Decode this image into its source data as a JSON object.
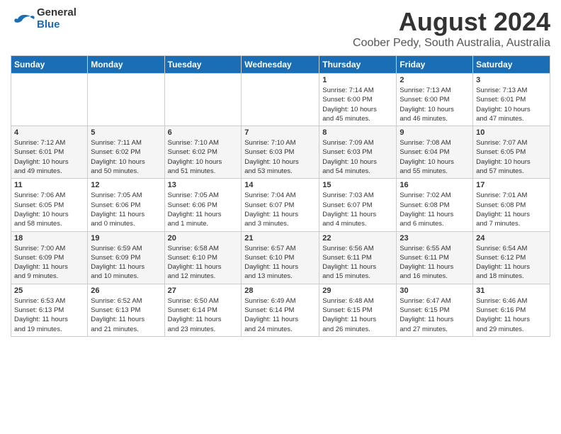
{
  "header": {
    "logo_general": "General",
    "logo_blue": "Blue",
    "main_title": "August 2024",
    "subtitle": "Coober Pedy, South Australia, Australia"
  },
  "days_of_week": [
    "Sunday",
    "Monday",
    "Tuesday",
    "Wednesday",
    "Thursday",
    "Friday",
    "Saturday"
  ],
  "weeks": [
    [
      {
        "day": "",
        "content": ""
      },
      {
        "day": "",
        "content": ""
      },
      {
        "day": "",
        "content": ""
      },
      {
        "day": "",
        "content": ""
      },
      {
        "day": "1",
        "content": "Sunrise: 7:14 AM\nSunset: 6:00 PM\nDaylight: 10 hours\nand 45 minutes."
      },
      {
        "day": "2",
        "content": "Sunrise: 7:13 AM\nSunset: 6:00 PM\nDaylight: 10 hours\nand 46 minutes."
      },
      {
        "day": "3",
        "content": "Sunrise: 7:13 AM\nSunset: 6:01 PM\nDaylight: 10 hours\nand 47 minutes."
      }
    ],
    [
      {
        "day": "4",
        "content": "Sunrise: 7:12 AM\nSunset: 6:01 PM\nDaylight: 10 hours\nand 49 minutes."
      },
      {
        "day": "5",
        "content": "Sunrise: 7:11 AM\nSunset: 6:02 PM\nDaylight: 10 hours\nand 50 minutes."
      },
      {
        "day": "6",
        "content": "Sunrise: 7:10 AM\nSunset: 6:02 PM\nDaylight: 10 hours\nand 51 minutes."
      },
      {
        "day": "7",
        "content": "Sunrise: 7:10 AM\nSunset: 6:03 PM\nDaylight: 10 hours\nand 53 minutes."
      },
      {
        "day": "8",
        "content": "Sunrise: 7:09 AM\nSunset: 6:03 PM\nDaylight: 10 hours\nand 54 minutes."
      },
      {
        "day": "9",
        "content": "Sunrise: 7:08 AM\nSunset: 6:04 PM\nDaylight: 10 hours\nand 55 minutes."
      },
      {
        "day": "10",
        "content": "Sunrise: 7:07 AM\nSunset: 6:05 PM\nDaylight: 10 hours\nand 57 minutes."
      }
    ],
    [
      {
        "day": "11",
        "content": "Sunrise: 7:06 AM\nSunset: 6:05 PM\nDaylight: 10 hours\nand 58 minutes."
      },
      {
        "day": "12",
        "content": "Sunrise: 7:05 AM\nSunset: 6:06 PM\nDaylight: 11 hours\nand 0 minutes."
      },
      {
        "day": "13",
        "content": "Sunrise: 7:05 AM\nSunset: 6:06 PM\nDaylight: 11 hours\nand 1 minute."
      },
      {
        "day": "14",
        "content": "Sunrise: 7:04 AM\nSunset: 6:07 PM\nDaylight: 11 hours\nand 3 minutes."
      },
      {
        "day": "15",
        "content": "Sunrise: 7:03 AM\nSunset: 6:07 PM\nDaylight: 11 hours\nand 4 minutes."
      },
      {
        "day": "16",
        "content": "Sunrise: 7:02 AM\nSunset: 6:08 PM\nDaylight: 11 hours\nand 6 minutes."
      },
      {
        "day": "17",
        "content": "Sunrise: 7:01 AM\nSunset: 6:08 PM\nDaylight: 11 hours\nand 7 minutes."
      }
    ],
    [
      {
        "day": "18",
        "content": "Sunrise: 7:00 AM\nSunset: 6:09 PM\nDaylight: 11 hours\nand 9 minutes."
      },
      {
        "day": "19",
        "content": "Sunrise: 6:59 AM\nSunset: 6:09 PM\nDaylight: 11 hours\nand 10 minutes."
      },
      {
        "day": "20",
        "content": "Sunrise: 6:58 AM\nSunset: 6:10 PM\nDaylight: 11 hours\nand 12 minutes."
      },
      {
        "day": "21",
        "content": "Sunrise: 6:57 AM\nSunset: 6:10 PM\nDaylight: 11 hours\nand 13 minutes."
      },
      {
        "day": "22",
        "content": "Sunrise: 6:56 AM\nSunset: 6:11 PM\nDaylight: 11 hours\nand 15 minutes."
      },
      {
        "day": "23",
        "content": "Sunrise: 6:55 AM\nSunset: 6:11 PM\nDaylight: 11 hours\nand 16 minutes."
      },
      {
        "day": "24",
        "content": "Sunrise: 6:54 AM\nSunset: 6:12 PM\nDaylight: 11 hours\nand 18 minutes."
      }
    ],
    [
      {
        "day": "25",
        "content": "Sunrise: 6:53 AM\nSunset: 6:13 PM\nDaylight: 11 hours\nand 19 minutes."
      },
      {
        "day": "26",
        "content": "Sunrise: 6:52 AM\nSunset: 6:13 PM\nDaylight: 11 hours\nand 21 minutes."
      },
      {
        "day": "27",
        "content": "Sunrise: 6:50 AM\nSunset: 6:14 PM\nDaylight: 11 hours\nand 23 minutes."
      },
      {
        "day": "28",
        "content": "Sunrise: 6:49 AM\nSunset: 6:14 PM\nDaylight: 11 hours\nand 24 minutes."
      },
      {
        "day": "29",
        "content": "Sunrise: 6:48 AM\nSunset: 6:15 PM\nDaylight: 11 hours\nand 26 minutes."
      },
      {
        "day": "30",
        "content": "Sunrise: 6:47 AM\nSunset: 6:15 PM\nDaylight: 11 hours\nand 27 minutes."
      },
      {
        "day": "31",
        "content": "Sunrise: 6:46 AM\nSunset: 6:16 PM\nDaylight: 11 hours\nand 29 minutes."
      }
    ]
  ],
  "colors": {
    "header_bg": "#1a6eb5",
    "header_text": "#ffffff",
    "odd_row_bg": "#ffffff",
    "even_row_bg": "#f5f5f5"
  }
}
